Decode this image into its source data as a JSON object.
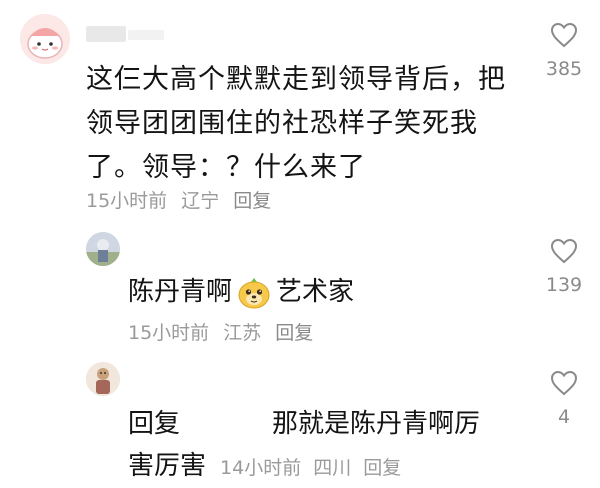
{
  "main_comment": {
    "text": "这仨大高个默默走到领导背后，把领导团团围住的社恐样子笑死我了。领导：？什么来了",
    "time": "15小时前",
    "location": "辽宁",
    "reply_label": "回复",
    "likes": "385",
    "avatar_icon": "cartoon-blob-avatar"
  },
  "reply1": {
    "name": "陈丹青啊",
    "badge_icon": "dog-face-emoji",
    "title": "艺术家",
    "time": "15小时前",
    "location": "江苏",
    "reply_label": "回复",
    "likes": "139",
    "avatar_icon": "photo-avatar"
  },
  "reply2": {
    "prefix": "回复",
    "text_line1": "那就是陈丹青啊厉",
    "text_line2": "害厉害",
    "time": "14小时前",
    "location": "四川",
    "reply_label": "回复",
    "likes": "4",
    "avatar_icon": "illustration-avatar"
  },
  "colors": {
    "text": "#141414",
    "meta": "#9a9a9a",
    "icon": "#8a8a8a"
  }
}
